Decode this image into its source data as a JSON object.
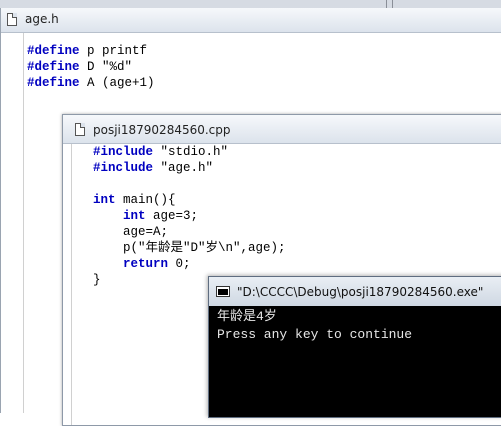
{
  "editor_age": {
    "title": "age.h",
    "lines": [
      {
        "kw": "#define",
        "rest": " p printf"
      },
      {
        "kw": "#define",
        "rest": " D \"%d\""
      },
      {
        "kw": "#define",
        "rest": " A (age+1)"
      }
    ]
  },
  "editor_cpp": {
    "title": "posji18790284560.cpp",
    "lines": [
      {
        "kw": "#include",
        "rest": " \"stdio.h\""
      },
      {
        "kw": "#include",
        "rest": " \"age.h\""
      },
      {
        "kw": "",
        "rest": ""
      },
      {
        "kw": "int",
        "rest": " main(){"
      },
      {
        "indent": "    ",
        "kw": "int",
        "rest": " age=3;"
      },
      {
        "indent": "    ",
        "kw": "",
        "rest": "age=A;"
      },
      {
        "indent": "    ",
        "kw": "",
        "rest": "p(\"年龄是\"D\"岁\\n\",age);"
      },
      {
        "indent": "    ",
        "kw": "return",
        "rest": " 0;"
      },
      {
        "kw": "",
        "rest": "}"
      }
    ]
  },
  "console": {
    "title": "\"D:\\CCCC\\Debug\\posji18790284560.exe\"",
    "output": [
      "年龄是4岁",
      "Press any key to continue"
    ]
  }
}
